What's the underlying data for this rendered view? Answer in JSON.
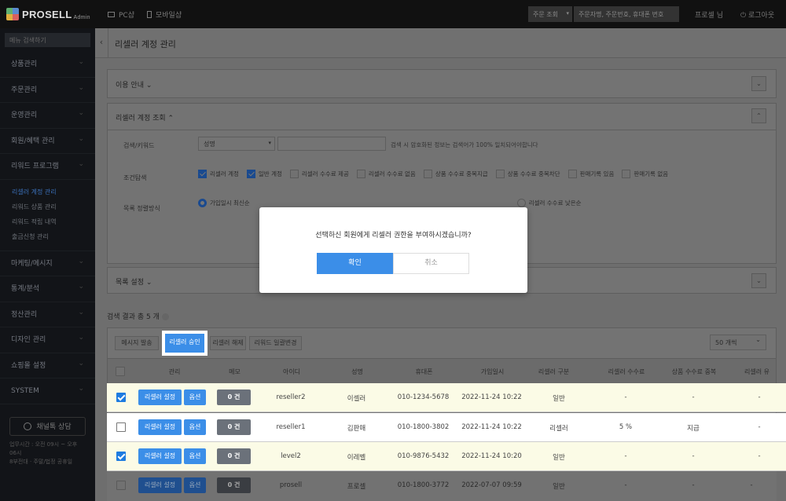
{
  "app": {
    "brand": "PROSELL",
    "brand_sub": "Admin"
  },
  "topbar": {
    "pc_label": "PC샵",
    "mobile_label": "모바일샵",
    "order_select": "주문 조회",
    "search_placeholder": "주문자명, 주문번호, 휴대폰 번호",
    "user": "프로셀 님",
    "logout": "로그아웃"
  },
  "sidebar": {
    "search_placeholder": "메뉴 검색하기",
    "menu_top": [
      "상품관리",
      "주문관리",
      "운영관리",
      "회원/혜택 관리",
      "리워드 프로그램"
    ],
    "submenu": [
      "리셀러 계정 관리",
      "리워드 상품 관리",
      "리워드 적립 내역",
      "출금신청 관리"
    ],
    "menu_bottom": [
      "마케팅/메시지",
      "통계/분석",
      "정산관리",
      "디자인 관리",
      "쇼핑몰 설정",
      "SYSTEM"
    ],
    "kakao": "채널톡 상담",
    "hours_1": "업무시간 : 오전 09시 ~ 오후 06시",
    "hours_2": "8부전대 · 주말/법정 공휴일"
  },
  "page": {
    "title": "리셀러 계정 관리",
    "back_icon": "‹"
  },
  "guide": {
    "title": "이용 안내 ⌄"
  },
  "search": {
    "title": "리셀러 계정 조회 ⌃",
    "label_keyword": "검색/키워드",
    "select_value": "성명",
    "note": "검색 시 암호화된 정보는 검색어가 100% 일치되어야합니다",
    "label_condition": "조건탐색",
    "checkboxes": [
      {
        "label": "리셀러 계정",
        "checked": true
      },
      {
        "label": "일반 계정",
        "checked": true
      },
      {
        "label": "리셀러 수수료 제공",
        "checked": false
      },
      {
        "label": "리셀러 수수료 없음",
        "checked": false
      },
      {
        "label": "상품 수수료 중복지급",
        "checked": false
      },
      {
        "label": "상품 수수료 중복차단",
        "checked": false
      },
      {
        "label": "판매기록 있음",
        "checked": false
      },
      {
        "label": "판매기록 없음",
        "checked": false
      }
    ],
    "label_sort": "목록 정렬방식",
    "radios": [
      {
        "label": "가입일시 최신순",
        "checked": true
      },
      {
        "label": "리셀러 수수료 낮은순",
        "checked": false
      }
    ]
  },
  "list_settings": {
    "title": "목록 설정 ⌄"
  },
  "results": {
    "count_label": "검색 결과 총 5 개",
    "actions": [
      "메시지 발송",
      "리셀러 승인",
      "리셀러 해제",
      "리워드 일괄변경"
    ],
    "page_size": "50 개씩"
  },
  "table": {
    "headers": [
      "관리",
      "메모",
      "아이디",
      "성명",
      "휴대폰",
      "가입일시",
      "리셀러 구분",
      "리셀러 수수료",
      "상품 수수료 중복",
      "리셀러 유"
    ],
    "set_label": "리셀러 설정",
    "opt_label": "옵션",
    "rows": [
      {
        "checked": true,
        "memo": "0 건",
        "id": "reseller2",
        "name": "이셀러",
        "phone": "010-1234-5678",
        "joined": "2022-11-24 10:22",
        "type": "일반",
        "fee": "-",
        "dup": "-",
        "extra": "-"
      },
      {
        "checked": false,
        "memo": "0 건",
        "id": "reseller1",
        "name": "김판매",
        "phone": "010-1800-3802",
        "joined": "2022-11-24 10:22",
        "type": "리셀러",
        "fee": "5 %",
        "dup": "지급",
        "extra": "-"
      },
      {
        "checked": true,
        "memo": "0 건",
        "id": "level2",
        "name": "이레벨",
        "phone": "010-9876-5432",
        "joined": "2022-11-24 10:20",
        "type": "일반",
        "fee": "-",
        "dup": "-",
        "extra": "-"
      },
      {
        "checked": false,
        "memo": "0 건",
        "id": "prosell",
        "name": "프로셀",
        "phone": "010-1800-3772",
        "joined": "2022-07-07 09:59",
        "type": "일반",
        "fee": "-",
        "dup": "-",
        "extra": "-"
      }
    ]
  },
  "modal": {
    "message": "선택하신 회원에게 리셀러 권한을 부여하시겠습니까?",
    "ok": "확인",
    "cancel": "취소"
  }
}
